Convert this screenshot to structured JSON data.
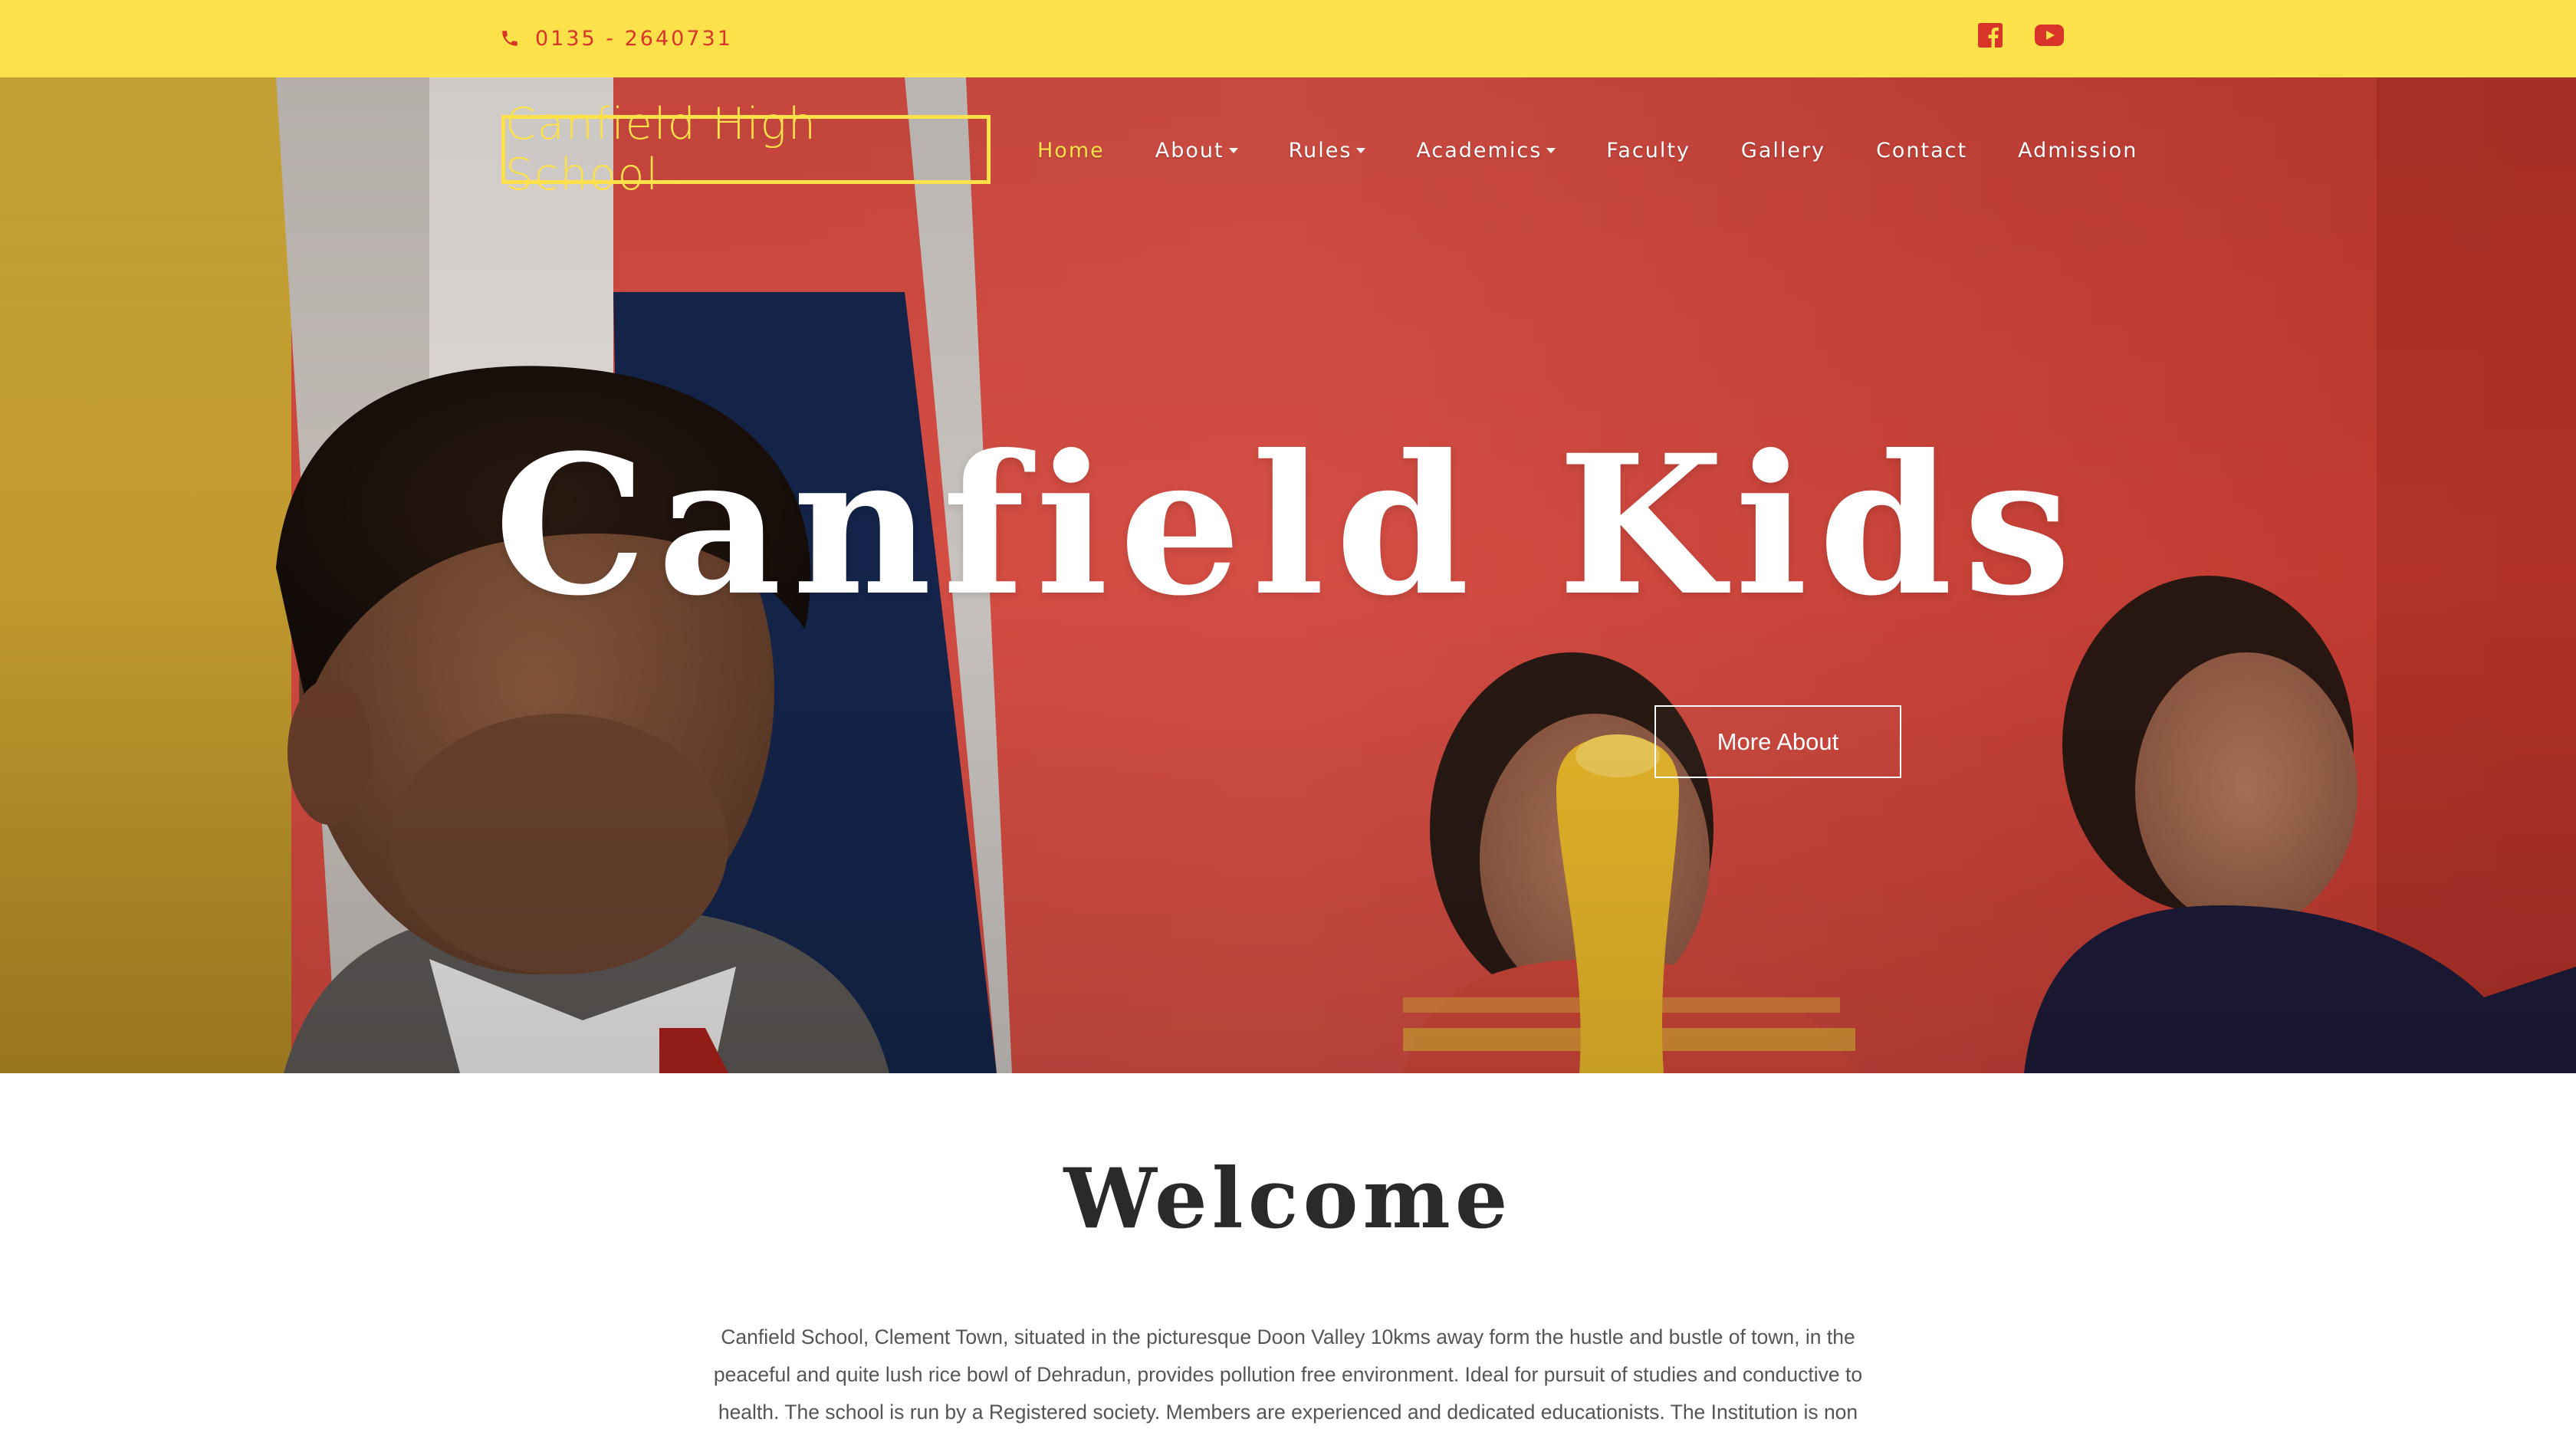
{
  "topbar": {
    "phone": "0135 - 2640731",
    "social": [
      {
        "name": "facebook-icon"
      },
      {
        "name": "youtube-icon"
      }
    ],
    "accent": "#fde14b",
    "icon_color": "#d8342a"
  },
  "header": {
    "brand": "Canfield High School",
    "nav": [
      {
        "label": "Home",
        "active": true,
        "dropdown": false
      },
      {
        "label": "About",
        "active": false,
        "dropdown": true
      },
      {
        "label": "Rules",
        "active": false,
        "dropdown": true
      },
      {
        "label": "Academics",
        "active": false,
        "dropdown": true
      },
      {
        "label": "Faculty",
        "active": false,
        "dropdown": false
      },
      {
        "label": "Gallery",
        "active": false,
        "dropdown": false
      },
      {
        "label": "Contact",
        "active": false,
        "dropdown": false
      },
      {
        "label": "Admission",
        "active": false,
        "dropdown": false
      }
    ]
  },
  "hero": {
    "title": "Canfield Kids",
    "cta": "More About"
  },
  "welcome": {
    "title": "Welcome",
    "text": "Canfield School, Clement Town, situated in the picturesque Doon Valley 10kms away form the hustle and bustle of town, in the peaceful and quite lush rice bowl of Dehradun, provides pollution free environment. Ideal for pursuit of studies and conductive to health. The school is run by a Registered society. Members are experienced and dedicated educationists. The Institution is non"
  }
}
